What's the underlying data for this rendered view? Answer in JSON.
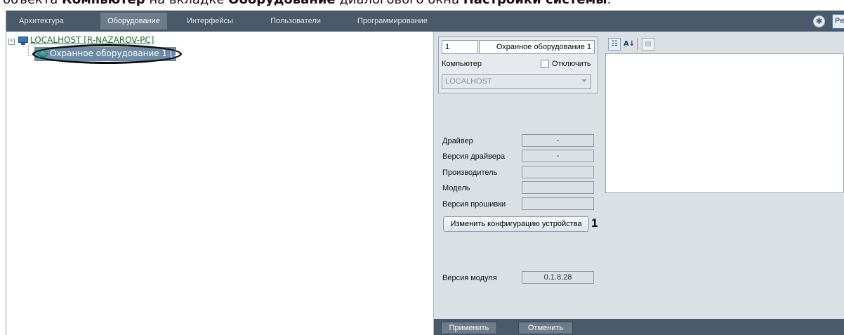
{
  "caption": {
    "part1": "объекта ",
    "bold1": "Компьютер",
    "part2": " на вкладке ",
    "bold2": "Оборудование",
    "part3": " диалогового окна ",
    "bold3": "Настройки системы",
    "part4": "."
  },
  "tabs": [
    {
      "label": "Архитектура",
      "active": false
    },
    {
      "label": "Оборудование",
      "active": true
    },
    {
      "label": "Интерфейсы",
      "active": false
    },
    {
      "label": "Пользователи",
      "active": false
    },
    {
      "label": "Программирование",
      "active": false
    }
  ],
  "toolbar": {
    "settings_icon": "gear-icon",
    "right_label": "Pe"
  },
  "tree": {
    "toggle": "−",
    "root_label": "LOCALHOST [R-NAZAROV-PC]",
    "child_label": "Охранное оборудование 1 [1]"
  },
  "props": {
    "id_value": "1",
    "name_value": "Охранное оборудование 1",
    "computer_label": "Компьютер",
    "disable_label": "Отключить",
    "computer_value": "LOCALHOST",
    "driver_label": "Драйвер",
    "driver_value": "-",
    "driver_version_label": "Версия драйвера",
    "driver_version_value": "-",
    "manufacturer_label": "Производитель",
    "manufacturer_value": "",
    "model_label": "Модель",
    "model_value": "",
    "firmware_label": "Версия прошивки",
    "firmware_value": "",
    "configure_button": "Изменить конфигурацию устройства",
    "callout_number": "1",
    "module_version_label": "Версия модуля",
    "module_version_value": "0.1.8.28"
  },
  "property_grid": {
    "categorized_icon": "categorized-icon",
    "sort_az_icon": "sort-az-icon",
    "sort_glyph": "A↓",
    "pages_icon": "property-pages-icon"
  },
  "buttons": {
    "apply": "Применить",
    "cancel": "Отменить"
  }
}
